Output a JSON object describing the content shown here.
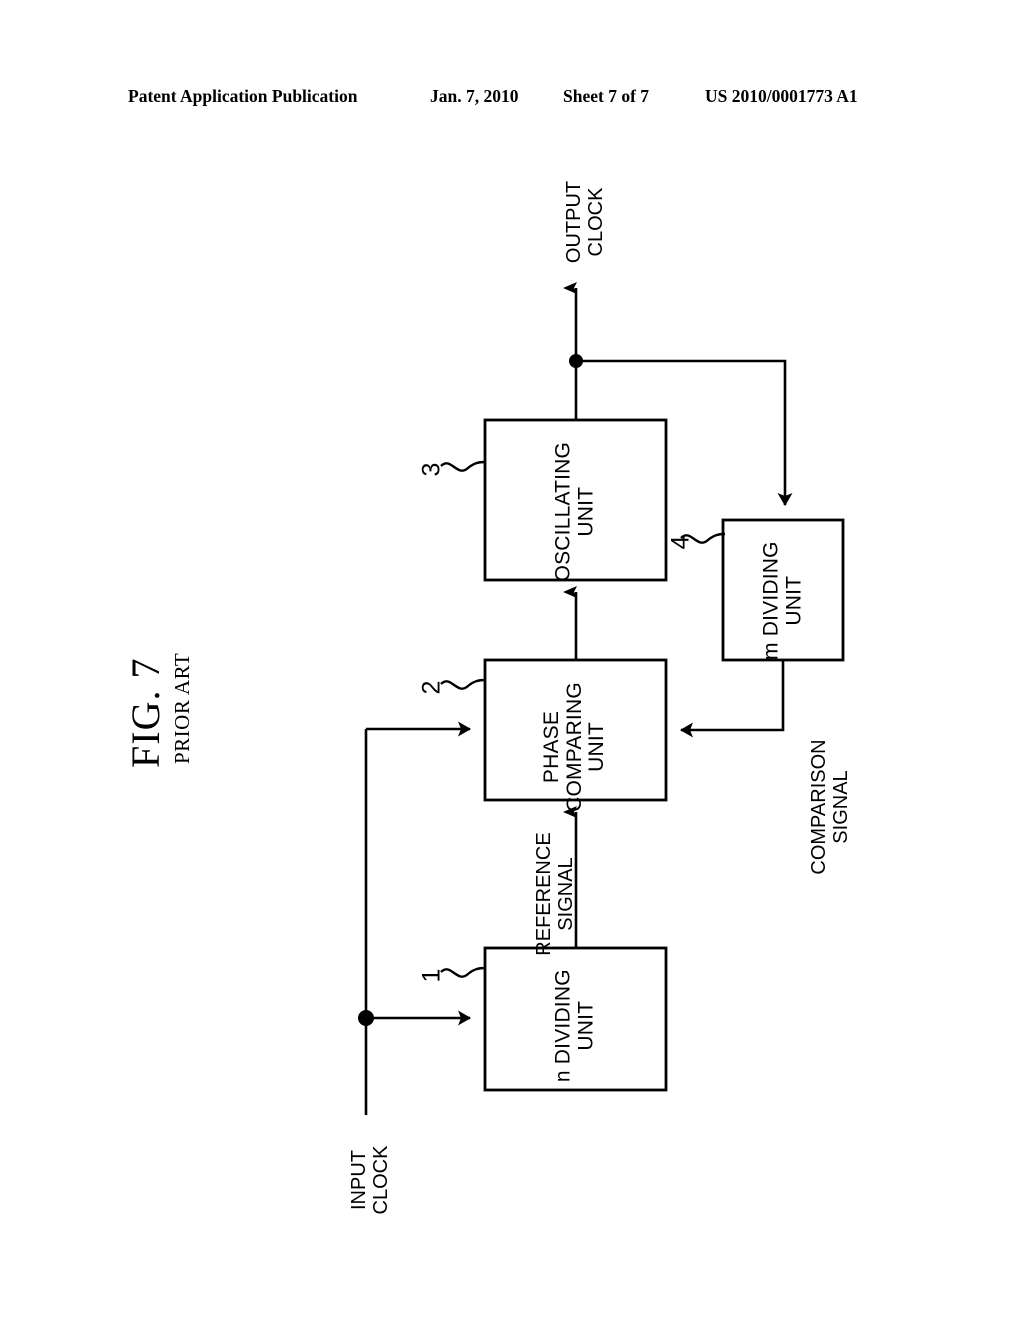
{
  "header": {
    "publication": "Patent Application Publication",
    "date": "Jan. 7, 2010",
    "sheet": "Sheet 7 of 7",
    "patent_number": "US 2010/0001773 A1"
  },
  "figure": {
    "title": "FIG. 7",
    "subtitle": "PRIOR ART"
  },
  "blocks": [
    {
      "id": "n-dividing-unit",
      "label": "n DIVIDING\nUNIT",
      "ref": "1"
    },
    {
      "id": "phase-comparing-unit",
      "label": "PHASE\nCOMPARING\nUNIT",
      "ref": "2"
    },
    {
      "id": "oscillating-unit",
      "label": "OSCILLATING\nUNIT",
      "ref": "3"
    },
    {
      "id": "m-dividing-unit",
      "label": "m DIVIDING\nUNIT",
      "ref": "4"
    }
  ],
  "signals": {
    "input_clock": "INPUT\nCLOCK",
    "output_clock": "OUTPUT\nCLOCK",
    "reference_signal": "REFERENCE\nSIGNAL",
    "comparison_signal": "COMPARISON\nSIGNAL"
  },
  "colors": {
    "ink": "#000000",
    "paper": "#ffffff"
  }
}
